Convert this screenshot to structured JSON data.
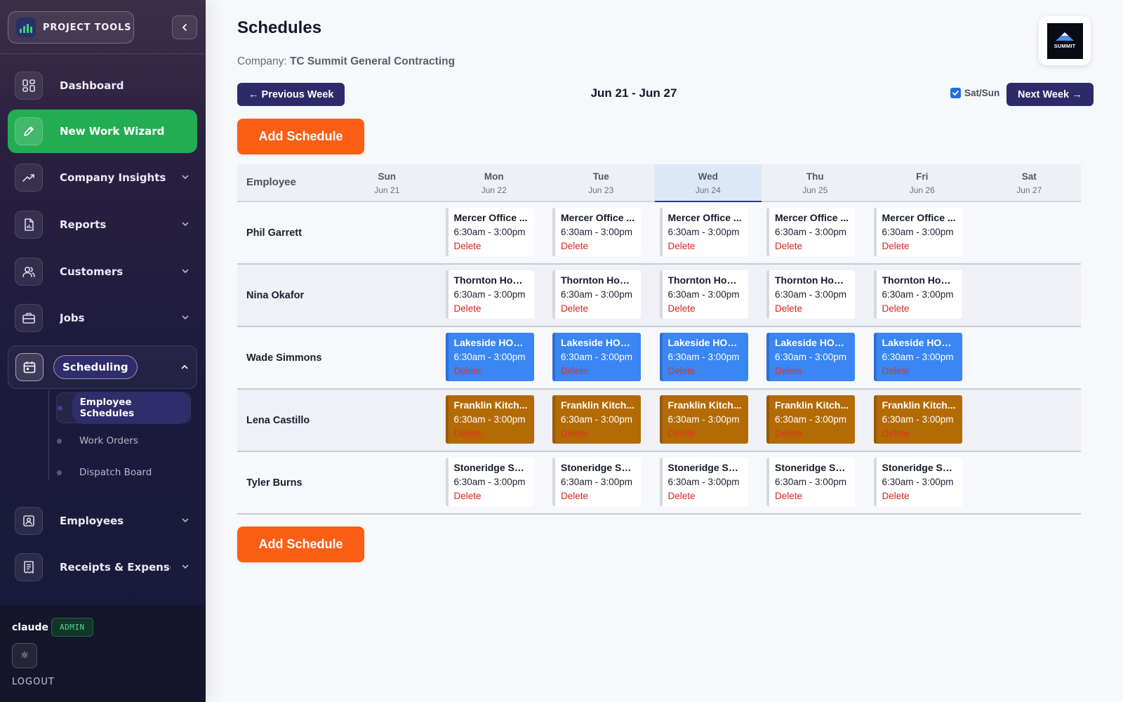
{
  "app": {
    "brand": "PROJECT TOOLS",
    "accent": "#23ad52",
    "primary": "#2e2a6a",
    "action": "#fb5e14"
  },
  "sidebar": {
    "items": [
      {
        "label": "Dashboard",
        "icon": "dashboard-grid-icon"
      },
      {
        "label": "New Work Wizard",
        "icon": "pencil-icon"
      },
      {
        "label": "Company Insights",
        "icon": "trending-up-icon"
      },
      {
        "label": "Reports",
        "icon": "report-file-icon"
      },
      {
        "label": "Customers",
        "icon": "users-icon"
      },
      {
        "label": "Jobs",
        "icon": "briefcase-icon"
      },
      {
        "label": "Scheduling",
        "icon": "calendar-icon"
      },
      {
        "label": "Employees",
        "icon": "id-badge-icon"
      },
      {
        "label": "Receipts & Expenses",
        "icon": "receipt-icon"
      }
    ],
    "sub_items": [
      {
        "label": "Employee Schedules"
      },
      {
        "label": "Work Orders"
      },
      {
        "label": "Dispatch Board"
      }
    ],
    "user": {
      "name": "claude",
      "role": "ADMIN"
    },
    "theme_icon": "☼",
    "logout": "LOGOUT"
  },
  "page": {
    "title": "Schedules",
    "company_label": "Company:",
    "company_name": "TC Summit General Contracting",
    "logo_text": "SUMMIT",
    "prev_week": "← Previous Week",
    "next_week": "Next Week →",
    "week_range": "Jun 21 - Jun 27",
    "satsun_label": "Sat/Sun",
    "satsun_checked": true,
    "add_schedule": "Add Schedule"
  },
  "schedule": {
    "employee_header": "Employee",
    "days": [
      {
        "name": "Sun",
        "date": "Jun 21"
      },
      {
        "name": "Mon",
        "date": "Jun 22"
      },
      {
        "name": "Tue",
        "date": "Jun 23"
      },
      {
        "name": "Wed",
        "date": "Jun 24",
        "today": true
      },
      {
        "name": "Thu",
        "date": "Jun 25"
      },
      {
        "name": "Fri",
        "date": "Jun 26"
      },
      {
        "name": "Sat",
        "date": "Jun 27"
      }
    ],
    "delete_label": "Delete",
    "rows": [
      {
        "employee": "Phil Garrett",
        "job": "Mercer Office ...",
        "time": "6:30am - 3:00pm",
        "style": "white"
      },
      {
        "employee": "Nina Okafor",
        "job": "Thornton Hom...",
        "time": "6:30am - 3:00pm",
        "style": "white"
      },
      {
        "employee": "Wade Simmons",
        "job": "Lakeside HOA ...",
        "time": "6:30am - 3:00pm",
        "style": "blue"
      },
      {
        "employee": "Lena Castillo",
        "job": "Franklin Kitch...",
        "time": "6:30am - 3:00pm",
        "style": "amber"
      },
      {
        "employee": "Tyler Burns",
        "job": "Stoneridge Sp...",
        "time": "6:30am - 3:00pm",
        "style": "white"
      }
    ]
  }
}
